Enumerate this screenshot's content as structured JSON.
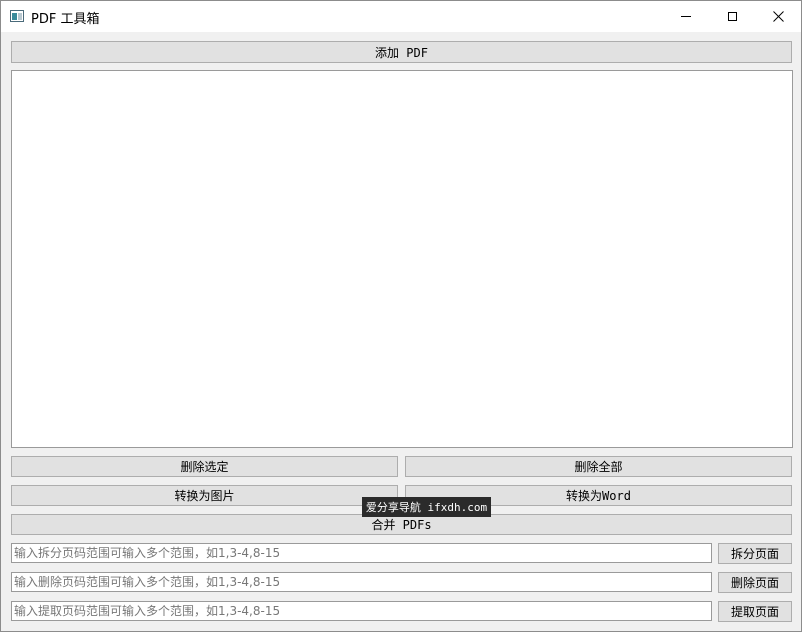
{
  "window": {
    "title": "PDF 工具箱",
    "icon": "app-window-icon",
    "controls": [
      "minimize-icon",
      "maximize-icon",
      "close-icon"
    ]
  },
  "buttons": {
    "add_pdf": "添加 PDF",
    "delete_selected": "删除选定",
    "delete_all": "删除全部",
    "convert_image": "转换为图片",
    "convert_word": "转换为Word",
    "merge": "合并 PDFs",
    "split_pages": "拆分页面",
    "delete_pages": "删除页面",
    "extract_pages": "提取页面"
  },
  "inputs": {
    "split_placeholder": "输入拆分页码范围可输入多个范围，如1,3-4,8-15",
    "delete_placeholder": "输入删除页码范围可输入多个范围，如1,3-4,8-15",
    "extract_placeholder": "输入提取页码范围可输入多个范围，如1,3-4,8-15"
  },
  "file_list": [],
  "watermark": "爱分享导航 ifxdh.com",
  "colors": {
    "button_bg": "#e1e1e1",
    "button_border": "#adadad",
    "window_bg": "#f0f0f0"
  }
}
